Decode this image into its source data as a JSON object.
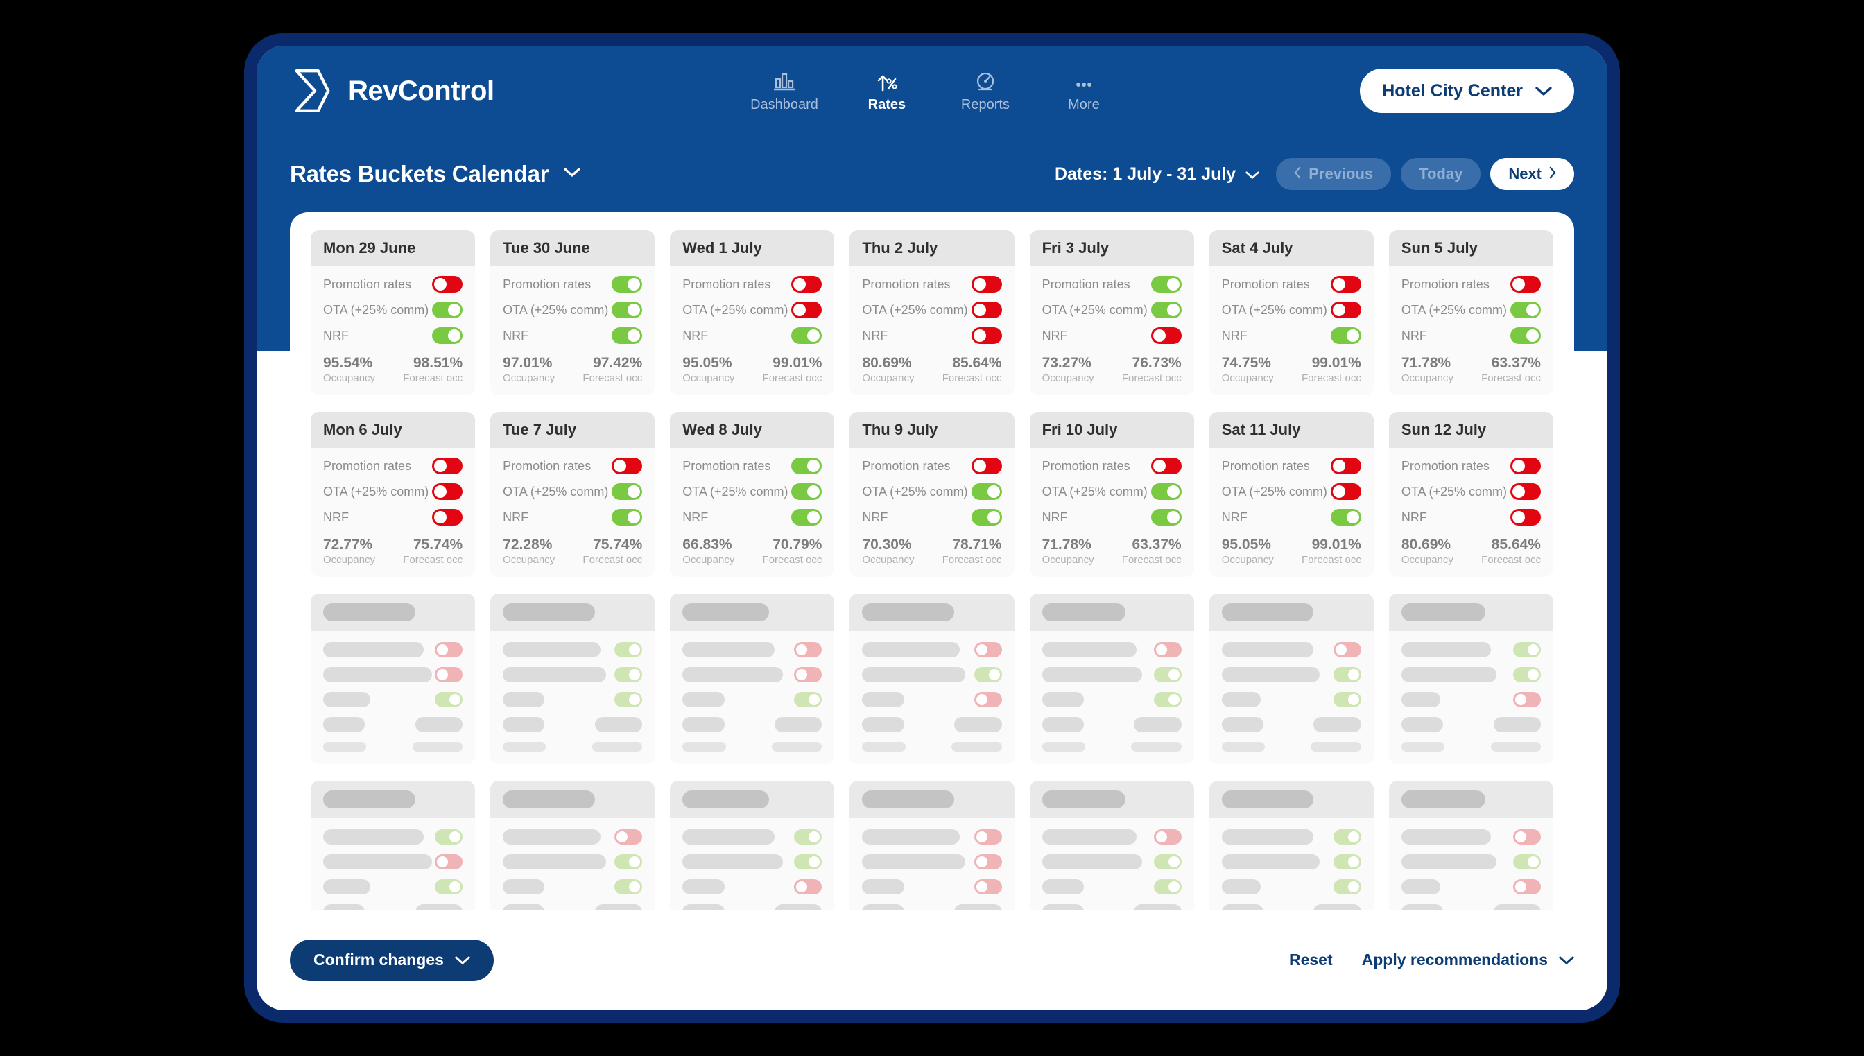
{
  "brand": {
    "name": "RevControl",
    "logo_icon": "revcontrol-logo-icon"
  },
  "nav": {
    "items": [
      {
        "label": "Dashboard",
        "icon": "bar-chart-icon",
        "active": false
      },
      {
        "label": "Rates",
        "icon": "rate-percent-arrow-icon",
        "active": true
      },
      {
        "label": "Reports",
        "icon": "gauge-icon",
        "active": false
      },
      {
        "label": "More",
        "icon": "ellipsis-icon",
        "active": false
      }
    ]
  },
  "hotel_selector": {
    "label": "Hotel City Center",
    "icon": "chevron-down-icon"
  },
  "subheader": {
    "title": "Rates Buckets Calendar",
    "title_icon": "chevron-down-icon",
    "date_range": "Dates: 1 July - 31 July",
    "date_icon": "chevron-down-icon",
    "previous": "Previous",
    "today": "Today",
    "next": "Next",
    "prev_icon": "chevron-left-icon",
    "next_icon": "chevron-right-icon"
  },
  "labels": {
    "promotion_rates": "Promotion rates",
    "ota": "OTA (+25% comm)",
    "nrf": "NRF",
    "occupancy": "Occupancy",
    "forecast": "Forecast occ"
  },
  "colors": {
    "brand_blue": "#0d4b92",
    "deep_blue": "#0d3c74",
    "toggle_on": "#7ac943",
    "toggle_off": "#e20613",
    "skeleton_on": "#cfe6b4",
    "skeleton_off": "#f0b3b6"
  },
  "calendar": {
    "rows": [
      {
        "type": "data",
        "days": [
          {
            "date": "Mon 29 June",
            "promotion_rates": false,
            "ota": true,
            "nrf": true,
            "occupancy": "95.54%",
            "forecast": "98.51%"
          },
          {
            "date": "Tue 30 June",
            "promotion_rates": true,
            "ota": true,
            "nrf": true,
            "occupancy": "97.01%",
            "forecast": "97.42%"
          },
          {
            "date": "Wed 1 July",
            "promotion_rates": false,
            "ota": false,
            "nrf": true,
            "occupancy": "95.05%",
            "forecast": "99.01%"
          },
          {
            "date": "Thu 2 July",
            "promotion_rates": false,
            "ota": false,
            "nrf": false,
            "occupancy": "80.69%",
            "forecast": "85.64%"
          },
          {
            "date": "Fri 3 July",
            "promotion_rates": true,
            "ota": true,
            "nrf": false,
            "occupancy": "73.27%",
            "forecast": "76.73%"
          },
          {
            "date": "Sat 4 July",
            "promotion_rates": false,
            "ota": false,
            "nrf": true,
            "occupancy": "74.75%",
            "forecast": "99.01%"
          },
          {
            "date": "Sun 5 July",
            "promotion_rates": false,
            "ota": true,
            "nrf": true,
            "occupancy": "71.78%",
            "forecast": "63.37%"
          }
        ]
      },
      {
        "type": "data",
        "days": [
          {
            "date": "Mon 6 July",
            "promotion_rates": false,
            "ota": false,
            "nrf": false,
            "occupancy": "72.77%",
            "forecast": "75.74%"
          },
          {
            "date": "Tue 7 July",
            "promotion_rates": false,
            "ota": true,
            "nrf": true,
            "occupancy": "72.28%",
            "forecast": "75.74%"
          },
          {
            "date": "Wed 8 July",
            "promotion_rates": true,
            "ota": true,
            "nrf": true,
            "occupancy": "66.83%",
            "forecast": "70.79%"
          },
          {
            "date": "Thu 9 July",
            "promotion_rates": false,
            "ota": true,
            "nrf": true,
            "occupancy": "70.30%",
            "forecast": "78.71%"
          },
          {
            "date": "Fri 10 July",
            "promotion_rates": false,
            "ota": true,
            "nrf": true,
            "occupancy": "71.78%",
            "forecast": "63.37%"
          },
          {
            "date": "Sat 11 July",
            "promotion_rates": false,
            "ota": false,
            "nrf": true,
            "occupancy": "95.05%",
            "forecast": "99.01%"
          },
          {
            "date": "Sun 12 July",
            "promotion_rates": false,
            "ota": false,
            "nrf": false,
            "occupancy": "80.69%",
            "forecast": "85.64%"
          }
        ]
      },
      {
        "type": "skeleton",
        "days": [
          {
            "toggles": [
              false,
              false,
              true
            ]
          },
          {
            "toggles": [
              true,
              true,
              true
            ]
          },
          {
            "toggles": [
              false,
              false,
              true
            ]
          },
          {
            "toggles": [
              false,
              true,
              false
            ]
          },
          {
            "toggles": [
              false,
              true,
              true
            ]
          },
          {
            "toggles": [
              false,
              true,
              true
            ]
          },
          {
            "toggles": [
              true,
              true,
              false
            ]
          }
        ]
      },
      {
        "type": "skeleton",
        "days": [
          {
            "toggles": [
              true,
              false,
              true
            ]
          },
          {
            "toggles": [
              false,
              true,
              true
            ]
          },
          {
            "toggles": [
              true,
              true,
              false
            ]
          },
          {
            "toggles": [
              false,
              false,
              false
            ]
          },
          {
            "toggles": [
              false,
              true,
              true
            ]
          },
          {
            "toggles": [
              true,
              true,
              true
            ]
          },
          {
            "toggles": [
              false,
              true,
              false
            ]
          }
        ]
      }
    ]
  },
  "footer": {
    "confirm": "Confirm changes",
    "confirm_icon": "chevron-down-icon",
    "reset": "Reset",
    "apply": "Apply recommendations",
    "apply_icon": "chevron-down-icon"
  }
}
